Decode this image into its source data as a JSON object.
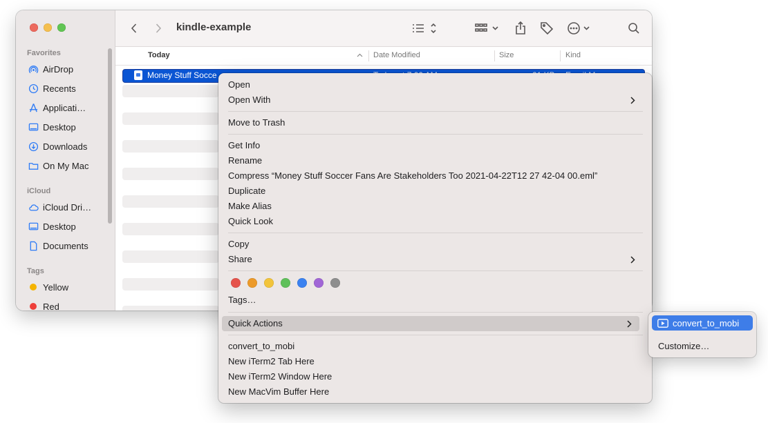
{
  "window": {
    "title": "kindle-example",
    "traffic_lights": [
      "close",
      "minimize",
      "zoom"
    ]
  },
  "toolbar": {
    "back_icon": "chevron-left-icon",
    "forward_icon": "chevron-right-icon",
    "view_icon": "list-view-icon",
    "group_icon": "group-grid-icon",
    "share_icon": "share-icon",
    "tag_icon": "tag-icon",
    "more_icon": "ellipsis-circle-icon",
    "search_icon": "search-icon"
  },
  "sidebar": {
    "favorites_label": "Favorites",
    "favorites": [
      {
        "label": "AirDrop",
        "icon": "airdrop-icon"
      },
      {
        "label": "Recents",
        "icon": "clock-icon"
      },
      {
        "label": "Applicati…",
        "icon": "applications-icon"
      },
      {
        "label": "Desktop",
        "icon": "desktop-icon"
      },
      {
        "label": "Downloads",
        "icon": "download-icon"
      },
      {
        "label": "On My Mac",
        "icon": "folder-icon"
      }
    ],
    "icloud_label": "iCloud",
    "icloud": [
      {
        "label": "iCloud Dri…",
        "icon": "cloud-icon"
      },
      {
        "label": "Desktop",
        "icon": "desktop-icon"
      },
      {
        "label": "Documents",
        "icon": "document-icon"
      }
    ],
    "tags_label": "Tags",
    "tags": [
      {
        "label": "Yellow",
        "color": "#f5b400"
      },
      {
        "label": "Red",
        "color": "#ee3f3a"
      }
    ]
  },
  "columns": {
    "name": "Today",
    "date_modified": "Date Modified",
    "size": "Size",
    "kind": "Kind"
  },
  "files": [
    {
      "name": "Money Stuff Socce",
      "date": "Today at 7:00 AM",
      "size": "21 KB",
      "kind": "Email Mess"
    }
  ],
  "context_menu": {
    "open": "Open",
    "open_with": "Open With",
    "move_to_trash": "Move to Trash",
    "get_info": "Get Info",
    "rename": "Rename",
    "compress": "Compress “Money Stuff Soccer Fans Are Stakeholders Too 2021-04-22T12 27 42-04 00.eml”",
    "duplicate": "Duplicate",
    "make_alias": "Make Alias",
    "quick_look": "Quick Look",
    "copy": "Copy",
    "share": "Share",
    "tag_colors": [
      "#e5534b",
      "#ec9a2a",
      "#f2c43b",
      "#5fc05a",
      "#3b82f0",
      "#a166d6",
      "#8e8e8e"
    ],
    "tags": "Tags…",
    "quick_actions": "Quick Actions",
    "convert_to_mobi": "convert_to_mobi",
    "new_iterm2_tab": "New iTerm2 Tab Here",
    "new_iterm2_window": "New iTerm2 Window Here",
    "new_macvim_buffer": "New MacVim Buffer Here"
  },
  "submenu": {
    "convert_to_mobi": "convert_to_mobi",
    "customize": "Customize…"
  },
  "colors": {
    "selection": "#0a55d3",
    "submenu_highlight": "#3e7de8"
  }
}
